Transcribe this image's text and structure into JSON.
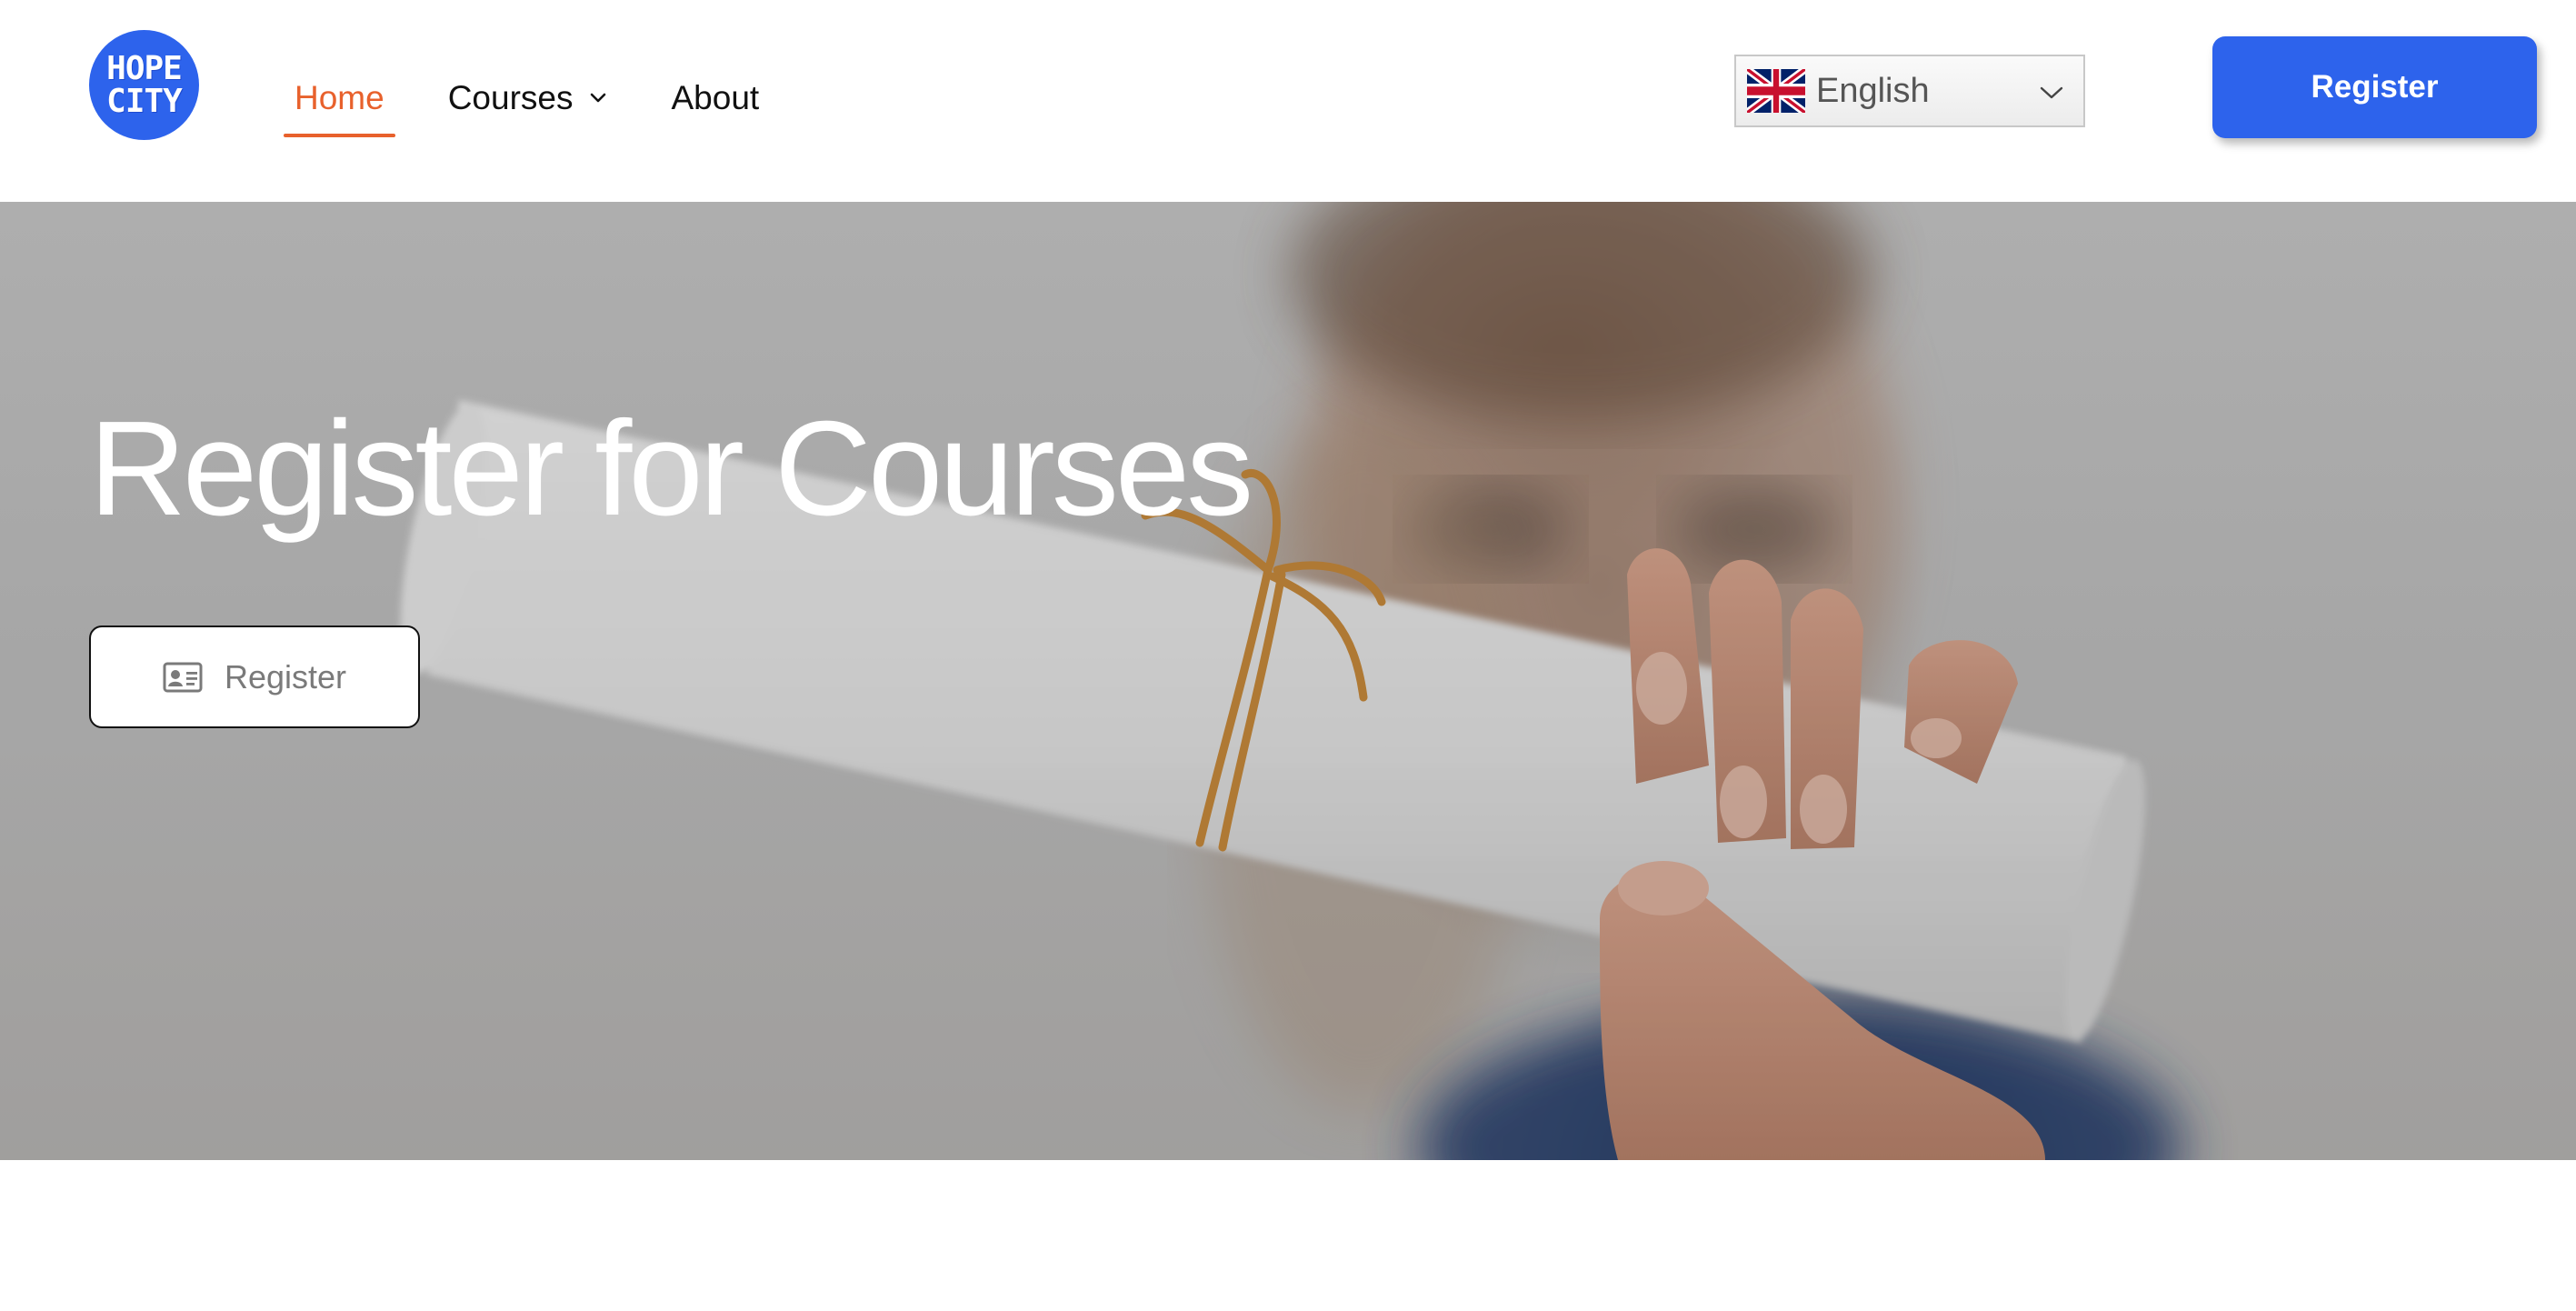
{
  "brand": {
    "logo_line1": "HOPE",
    "logo_line2": "CITY",
    "color": "#2d63ec"
  },
  "nav": {
    "items": [
      {
        "label": "Home",
        "active": true
      },
      {
        "label": "Courses",
        "has_dropdown": true
      },
      {
        "label": "About"
      }
    ],
    "active_color": "#e8612c"
  },
  "language": {
    "selected": "English",
    "flag_icon": "uk-flag-icon"
  },
  "header": {
    "register_label": "Register"
  },
  "hero": {
    "title": "Register for Courses",
    "button_label": "Register",
    "button_icon": "id-card-icon"
  }
}
